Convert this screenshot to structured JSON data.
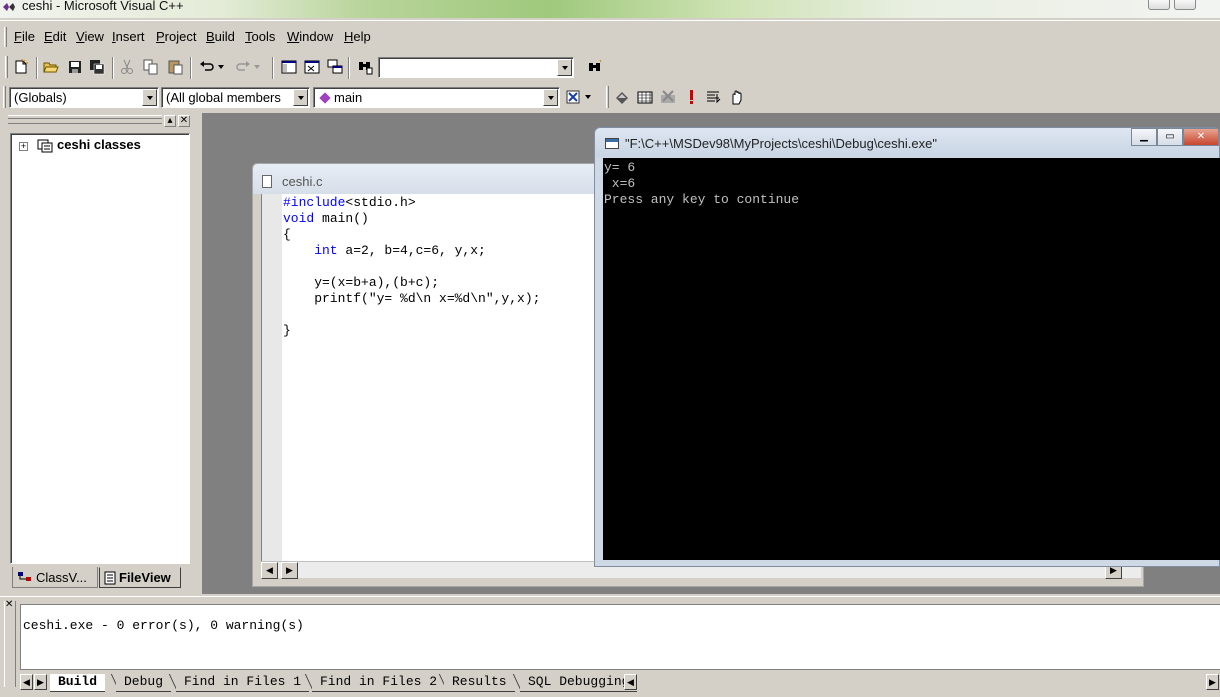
{
  "window": {
    "title": "ceshi - Microsoft Visual C++"
  },
  "menu": {
    "items": [
      "File",
      "Edit",
      "View",
      "Insert",
      "Project",
      "Build",
      "Tools",
      "Window",
      "Help"
    ],
    "mnemonics": [
      "F",
      "E",
      "V",
      "I",
      "P",
      "B",
      "T",
      "W",
      "H"
    ]
  },
  "toolbar": {
    "find_combo_value": "",
    "icons": [
      "new-file-icon",
      "open-icon",
      "save-icon",
      "save-all-icon",
      "cut-icon",
      "copy-icon",
      "paste-icon",
      "undo-icon",
      "redo-icon",
      "workspace-icon",
      "output-icon",
      "window-list-icon",
      "find-in-files-icon",
      "find-icon"
    ]
  },
  "wizardbar": {
    "scope": "(Globals)",
    "filter": "(All global members",
    "member": "main",
    "icons": [
      "wizard-action-icon",
      "compile-icon",
      "build-icon",
      "stop-build-icon",
      "execute-icon",
      "insert-remove-breakpoint-icon",
      "go-icon"
    ]
  },
  "workspace": {
    "root": "ceshi classes",
    "tabs": [
      {
        "label": "ClassV...",
        "active": false
      },
      {
        "label": "FileView",
        "active": true
      }
    ]
  },
  "editor": {
    "filename": "ceshi.c",
    "code": [
      {
        "kw": "#include",
        "rest": "<stdio.h>"
      },
      {
        "kw": "void",
        "rest": " main()"
      },
      {
        "kw": "",
        "rest": "{"
      },
      {
        "kw": "    int",
        "rest": " a=2, b=4,c=6, y,x;"
      },
      {
        "kw": "",
        "rest": ""
      },
      {
        "kw": "",
        "rest": "    y=(x=b+a),(b+c);"
      },
      {
        "kw": "",
        "rest": "    printf(\"y= %d\\n x=%d\\n\",y,x);"
      },
      {
        "kw": "",
        "rest": ""
      },
      {
        "kw": "",
        "rest": "}"
      }
    ]
  },
  "console": {
    "title": "\"F:\\C++\\MSDev98\\MyProjects\\ceshi\\Debug\\ceshi.exe\"",
    "output": "y= 6\n x=6\nPress any key to continue"
  },
  "output_pane": {
    "text": "ceshi.exe - 0 error(s), 0 warning(s)",
    "tabs": [
      {
        "label": "Build",
        "active": true
      },
      {
        "label": "Debug",
        "active": false
      },
      {
        "label": "Find in Files 1",
        "active": false
      },
      {
        "label": "Find in Files 2",
        "active": false
      },
      {
        "label": "Results",
        "active": false
      },
      {
        "label": "SQL Debugging",
        "active": false
      }
    ]
  },
  "colors": {
    "chrome": "#d4d0c8",
    "keyword": "#0000ff",
    "console_bg": "#000000",
    "console_fg": "#c0c0c0"
  }
}
